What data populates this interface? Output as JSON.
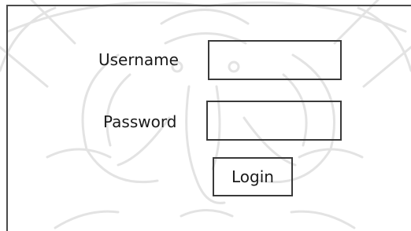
{
  "watermark": {
    "icon": "elephant-seal-icon",
    "color": "#e6e6e6"
  },
  "form": {
    "username_label": "Username",
    "username_value": "",
    "password_label": "Password",
    "password_value": "",
    "login_label": "Login"
  }
}
